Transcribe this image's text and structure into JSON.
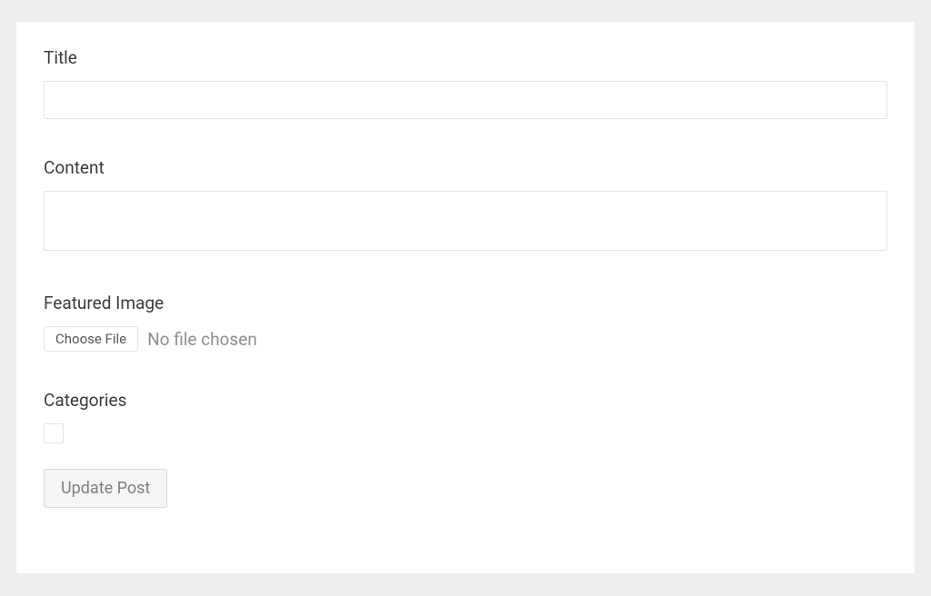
{
  "form": {
    "title": {
      "label": "Title",
      "value": ""
    },
    "content": {
      "label": "Content",
      "value": ""
    },
    "featured_image": {
      "label": "Featured Image",
      "button_label": "Choose File",
      "status_text": "No file chosen"
    },
    "categories": {
      "label": "Categories"
    },
    "submit_label": "Update Post"
  }
}
